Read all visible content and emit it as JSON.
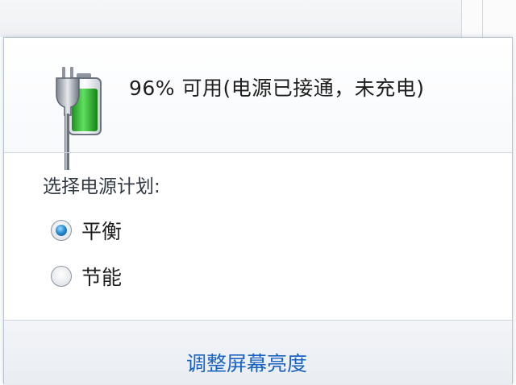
{
  "status": {
    "text": "96% 可用(电源已接通，未充电)",
    "battery_percent": 96,
    "icon": "battery-plugged-icon"
  },
  "plans": {
    "label": "选择电源计划:",
    "options": [
      {
        "label": "平衡",
        "selected": true
      },
      {
        "label": "节能",
        "selected": false
      }
    ]
  },
  "footer": {
    "brightness_link": "调整屏幕亮度"
  },
  "colors": {
    "link": "#1b63c2",
    "battery_fill": "#3cc43c",
    "radio_selected": "#2a8ed6"
  }
}
